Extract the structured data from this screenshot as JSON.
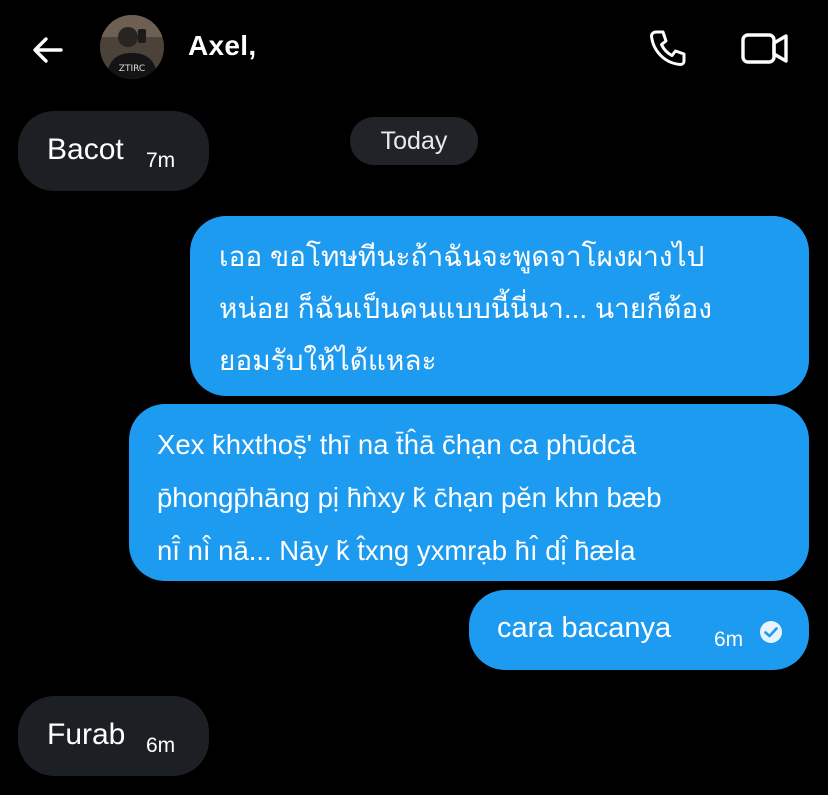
{
  "header": {
    "contact_name": "Axel,",
    "back_icon": "arrow-left-icon",
    "call_icon": "phone-icon",
    "video_icon": "video-camera-icon"
  },
  "date_separator": "Today",
  "messages": [
    {
      "direction": "incoming",
      "text": "Bacot",
      "time": "7m"
    },
    {
      "direction": "outgoing",
      "text": "เออ ขอโทษทีนะถ้าฉันจะพูดจาโผงผางไป\nหน่อย ก็ฉันเป็นคนแบบนี้นี่นา... นายก็ต้อง\nยอมรับให้ได้แหละ"
    },
    {
      "direction": "outgoing",
      "text": "Xex k̄hxthoṣ̄' thī na t̄ĥā c̄hạn ca phūdcā\np̄hongp̄hāng pị h̄ǹxy k̆ c̄hạn pĕn khn bæb\nnī̂ nì̂ nā... Nāy k̆ t̂xng yxmrạb h̄ı̂ dị̂ h̄æla"
    },
    {
      "direction": "outgoing",
      "text": "cara bacanya",
      "time": "6m",
      "status": "read"
    },
    {
      "direction": "incoming",
      "text": "Furab",
      "time": "6m"
    }
  ],
  "colors": {
    "background": "#000000",
    "outgoing_bubble": "#1d9bf0",
    "incoming_bubble": "#1c1f23",
    "pill": "#202327"
  }
}
